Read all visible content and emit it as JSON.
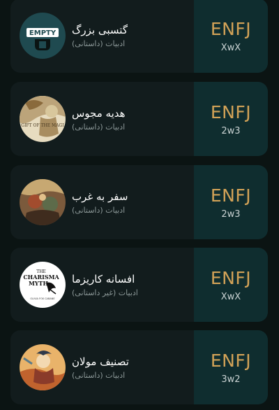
{
  "items": [
    {
      "title": "گتسبی بزرگ",
      "subtitle": "ادبیات (داستانی)",
      "type_code": "ENFJ",
      "type_variant": "XwX",
      "cover_text": "EMPTY"
    },
    {
      "title": "هدیه مجوس",
      "subtitle": "ادبیات (داستانی)",
      "type_code": "ENFJ",
      "type_variant": "2w3",
      "cover_text": "GIFT OF THE MAGI"
    },
    {
      "title": "سفر به غرب",
      "subtitle": "ادبیات (داستانی)",
      "type_code": "ENFJ",
      "type_variant": "2w3"
    },
    {
      "title": "افسانه کاریزما",
      "subtitle": "ادبیات (غیر داستانی)",
      "type_code": "ENFJ",
      "type_variant": "XwX",
      "cover_text_1": "THE",
      "cover_text_2": "CHARISMA",
      "cover_text_3": "MYTH",
      "cover_text_4": "OLIVIA FOX CABANE"
    },
    {
      "title": "تصنیف مولان",
      "subtitle": "ادبیات (داستانی)",
      "type_code": "ENFJ",
      "type_variant": "3w2"
    }
  ],
  "colors": {
    "page_background": "#0b1413",
    "card_background": "#121c1d",
    "type_panel_background": "#0f2d2f",
    "type_code": "#d2a257",
    "title": "#ffffff",
    "subtitle": "#8c9898"
  }
}
